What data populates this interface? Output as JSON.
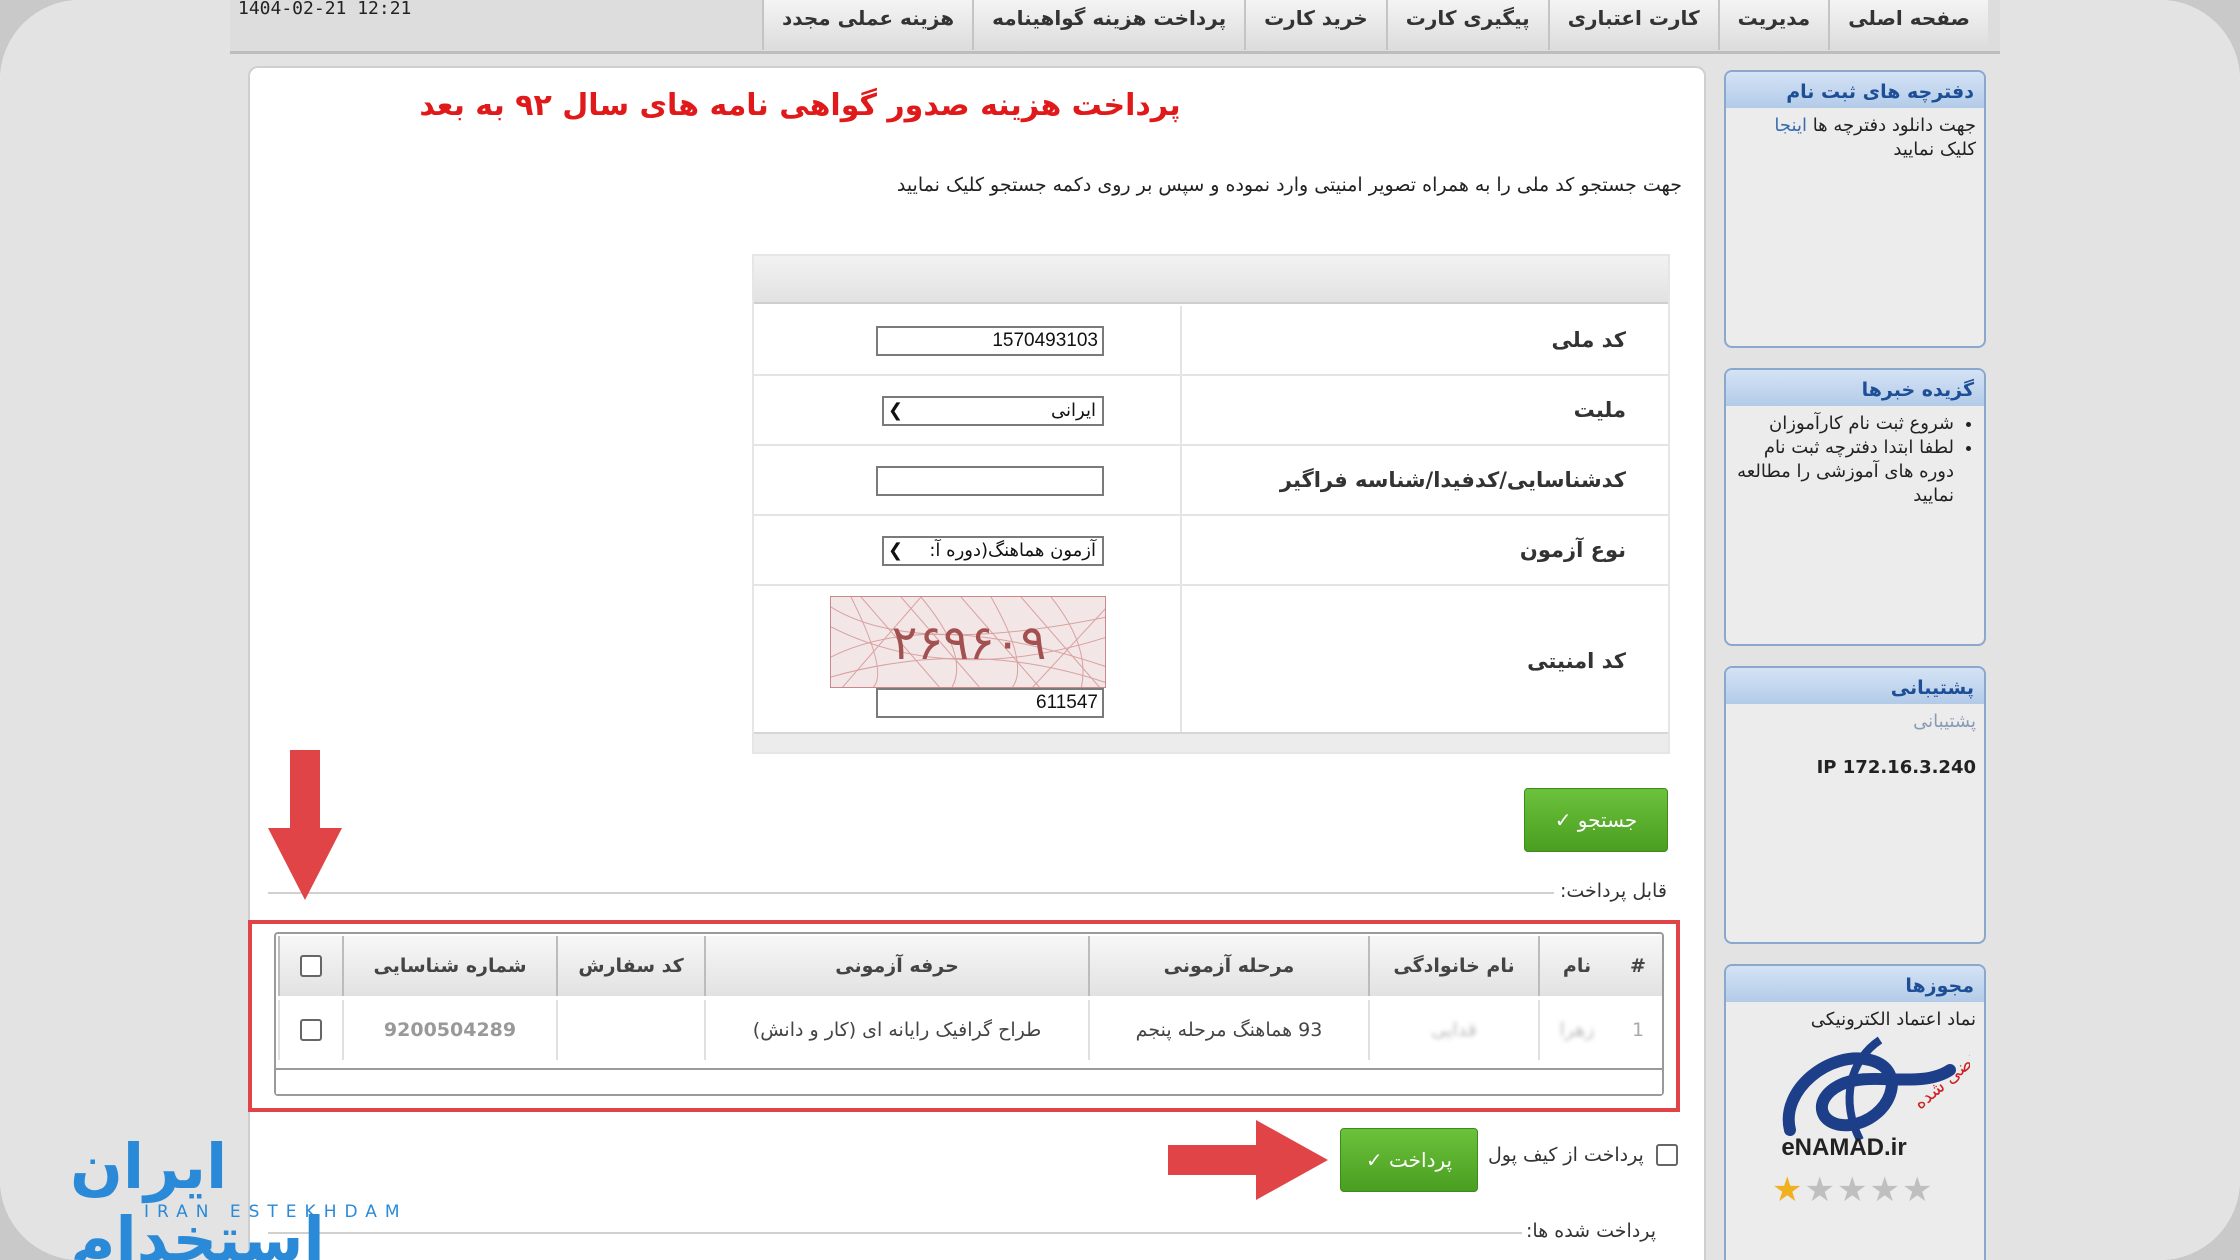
{
  "header": {
    "datetime": "1404-02-21 12:21",
    "nav": [
      "صفحه اصلی",
      "مدیریت",
      "کارت اعتباری",
      "پیگیری کارت",
      "خرید کارت",
      "پرداخت هزینه گواهینامه",
      "هزینه عملی مجدد"
    ]
  },
  "main": {
    "title": "پرداخت هزینه صدور گواهی نامه های سال ۹۲ به بعد",
    "instruction": "جهت جستجو کد ملی را به همراه تصویر امنیتی وارد نموده و سپس بر روی دکمه جستجو کلیک نمایید"
  },
  "form": {
    "national_code_label": "کد ملی",
    "national_code_value": "1570493103",
    "nationality_label": "ملیت",
    "nationality_value": "ایرانی",
    "id_label": "کدشناسایی/کدفیدا/شناسه فراگیر",
    "id_value": "",
    "exam_type_label": "نوع آزمون",
    "exam_type_value": "آزمون هماهنگ(دوره آ:",
    "captcha_label": "کد امنیتی",
    "captcha_image_text": "۲۶۹۶۰۹",
    "captcha_value": "611547",
    "search_button": "جستجو ✓"
  },
  "payable": {
    "label": "قابل پرداخت:",
    "columns": [
      "#",
      "نام",
      "نام خانوادگی",
      "مرحله آزمونی",
      "حرفه آزمونی",
      "کد سفارش",
      "شماره شناسایی"
    ],
    "rows": [
      {
        "num": "1",
        "first_name": "زهرا",
        "last_name": "قدایی",
        "stage": "93 هماهنگ مرحله پنجم",
        "profession": "طراح گرافیک رایانه ای (کار و دانش)",
        "order_code": "",
        "id_number": "9200504289"
      }
    ],
    "wallet_label": "پرداخت از کیف پول",
    "pay_button": "پرداخت ✓"
  },
  "paid": {
    "label": "پرداخت شده ها:"
  },
  "sidebar": {
    "reg_title": "دفترچه های ثبت نام",
    "reg_text_1": "جهت دانلود دفترچه ها",
    "reg_link": "اینجا",
    "reg_text_2": "کلیک نمایید",
    "news_title": "گزیده خبرها",
    "news_items": [
      "شروع ثبت نام کارآموزان",
      "لطفا ابتدا دفترچه ثبت نام دوره های آموزشی را مطالعه نمایید"
    ],
    "support_title": "پشتیبانی",
    "support_link": "پشتیبانی",
    "ip_text": "IP 172.16.3.240",
    "licenses_title": "مجوزها",
    "licenses_text": "نماد اعتماد الکترونیکی",
    "enamad_text": "eNAMAD.ir",
    "enamad_stars": 1,
    "enamad_badge_text": "منقضی شده"
  },
  "watermark": {
    "main": "ایران استخدام",
    "sub": "IRAN ESTEKHDAM"
  },
  "colors": {
    "accent_red": "#e01a1a",
    "button_green": "#5aae2e",
    "sidebar_blue": "#1e4f96",
    "annotation_red": "#e04446",
    "watermark_blue": "#2a8ad8"
  }
}
